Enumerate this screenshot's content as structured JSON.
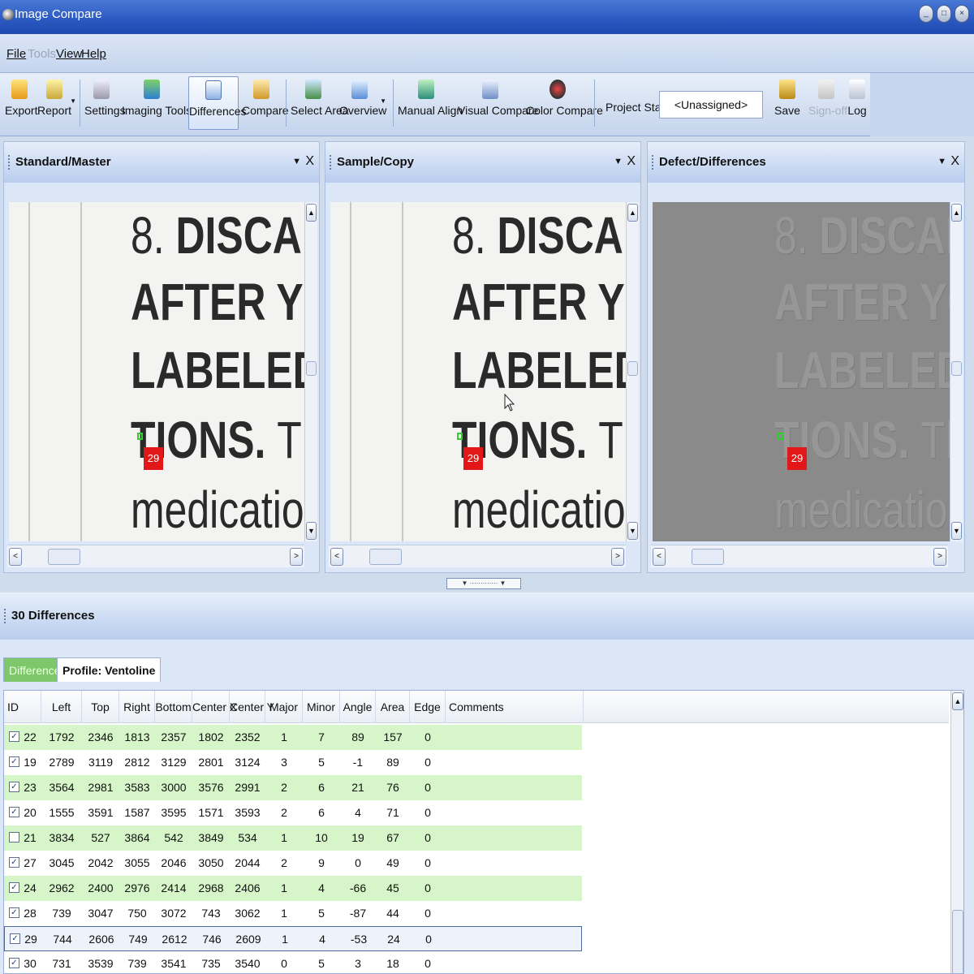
{
  "window": {
    "title": "Image Compare",
    "minimize": "_",
    "maximize": "□",
    "close": "×"
  },
  "menu": [
    {
      "label": "File",
      "enabled": true
    },
    {
      "label": "Tools",
      "enabled": false
    },
    {
      "label": "View",
      "enabled": true
    },
    {
      "label": "Help",
      "enabled": true
    }
  ],
  "toolbar": {
    "export": "Export",
    "report": "Report",
    "settings": "Settings",
    "imaging_tools": "Imaging Tools",
    "differences": "Differences",
    "compare": "Compare",
    "select_area": "Select Area",
    "overview": "Overview",
    "manual_align": "Manual Align",
    "visual_compare": "Visual Compare",
    "color_compare": "Color Compare",
    "project_status_label": "Project Status",
    "project_status_value": "<Unassigned>",
    "save": "Save",
    "sign_off": "Sign-off",
    "log": "Log"
  },
  "panels": {
    "standard": {
      "title": "Standard/Master"
    },
    "sample": {
      "title": "Sample/Copy"
    },
    "defect": {
      "title": "Defect/Differences"
    },
    "menu_glyph": "▼",
    "close_glyph": "X"
  },
  "document_text": {
    "line1_num": "8.",
    "line1": "DISCARD T",
    "line2": "AFTER YOU H",
    "line3": "LABELED NUN",
    "line4_bold": "TIONS.",
    "line4_rest": "The cc",
    "line5": "medication in"
  },
  "marker_label": "29",
  "scroll_glyphs": {
    "up": "▲",
    "down": "▼",
    "left": "<",
    "right": ">",
    "thumb": "III"
  },
  "differences": {
    "title": "30 Differences",
    "tabs": {
      "active": "Differences",
      "profile": "Profile: Ventoline"
    },
    "columns": [
      "ID",
      "Left",
      "Top",
      "Right",
      "Bottom",
      "Center X",
      "Center Y",
      "Major",
      "Minor",
      "Angle",
      "Area",
      "Edge",
      "Comments"
    ],
    "rows": [
      {
        "checked": true,
        "cells": [
          "22",
          "1792",
          "2346",
          "1813",
          "2357",
          "1802",
          "2352",
          "1",
          "7",
          "89",
          "157",
          "0",
          ""
        ]
      },
      {
        "checked": true,
        "cells": [
          "19",
          "2789",
          "3119",
          "2812",
          "3129",
          "2801",
          "3124",
          "3",
          "5",
          "-1",
          "89",
          "0",
          ""
        ]
      },
      {
        "checked": true,
        "cells": [
          "23",
          "3564",
          "2981",
          "3583",
          "3000",
          "3576",
          "2991",
          "2",
          "6",
          "21",
          "76",
          "0",
          ""
        ]
      },
      {
        "checked": true,
        "cells": [
          "20",
          "1555",
          "3591",
          "1587",
          "3595",
          "1571",
          "3593",
          "2",
          "6",
          "4",
          "71",
          "0",
          ""
        ]
      },
      {
        "checked": false,
        "cells": [
          "21",
          "3834",
          "527",
          "3864",
          "542",
          "3849",
          "534",
          "1",
          "10",
          "19",
          "67",
          "0",
          ""
        ]
      },
      {
        "checked": true,
        "cells": [
          "27",
          "3045",
          "2042",
          "3055",
          "2046",
          "3050",
          "2044",
          "2",
          "9",
          "0",
          "49",
          "0",
          ""
        ]
      },
      {
        "checked": true,
        "cells": [
          "24",
          "2962",
          "2400",
          "2976",
          "2414",
          "2968",
          "2406",
          "1",
          "4",
          "-66",
          "45",
          "0",
          ""
        ]
      },
      {
        "checked": true,
        "cells": [
          "28",
          "739",
          "3047",
          "750",
          "3072",
          "743",
          "3062",
          "1",
          "5",
          "-87",
          "44",
          "0",
          ""
        ]
      },
      {
        "checked": true,
        "cells": [
          "29",
          "744",
          "2606",
          "749",
          "2612",
          "746",
          "2609",
          "1",
          "4",
          "-53",
          "24",
          "0",
          ""
        ]
      },
      {
        "checked": true,
        "cells": [
          "30",
          "731",
          "3539",
          "739",
          "3541",
          "735",
          "3540",
          "0",
          "5",
          "3",
          "18",
          "0",
          ""
        ]
      }
    ]
  },
  "colors": {
    "row_highlight": "#d6f5c8",
    "marker": "#e21818",
    "active_tab": "#7ec86b"
  }
}
